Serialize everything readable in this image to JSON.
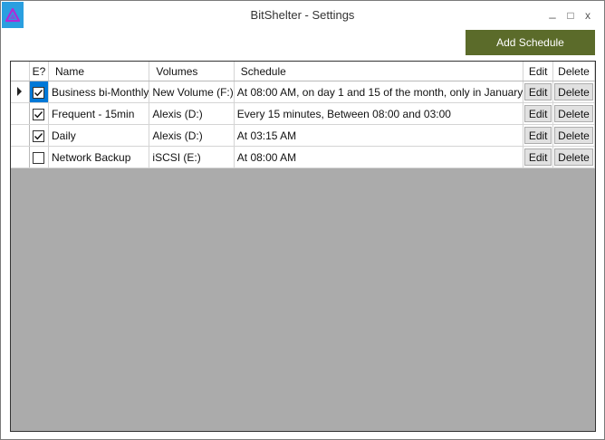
{
  "window": {
    "title": "BitShelter -  Settings",
    "icon": "bitshelter-logo",
    "controls": [
      "minimize",
      "maximize",
      "close"
    ],
    "min_glyph": "_",
    "max_glyph": "□",
    "close_glyph": "x"
  },
  "toolbar": {
    "add_schedule_label": "Add Schedule",
    "accent": "#5b6b2a"
  },
  "grid": {
    "columns": {
      "enabled": "E?",
      "name": "Name",
      "volumes": "Volumes",
      "schedule": "Schedule",
      "edit": "Edit",
      "delete": "Delete"
    },
    "rows": [
      {
        "enabled": true,
        "name": "Business bi-Monthly",
        "volumes": "New Volume (F:)",
        "schedule": "At 08:00 AM, on day 1 and 15 of the month, only in January",
        "edit": "Edit",
        "delete": "Delete",
        "current": true
      },
      {
        "enabled": true,
        "name": "Frequent - 15min",
        "volumes": "Alexis (D:)",
        "schedule": "Every 15 minutes, Between 08:00 and 03:00",
        "edit": "Edit",
        "delete": "Delete"
      },
      {
        "enabled": true,
        "name": "Daily",
        "volumes": "Alexis (D:)",
        "schedule": "At 03:15 AM",
        "edit": "Edit",
        "delete": "Delete"
      },
      {
        "enabled": false,
        "name": "Network Backup",
        "volumes": "iSCSI (E:)",
        "schedule": "At 08:00 AM",
        "edit": "Edit",
        "delete": "Delete"
      }
    ],
    "selection_color": "#0078d7",
    "empty_area_color": "#ababab"
  }
}
